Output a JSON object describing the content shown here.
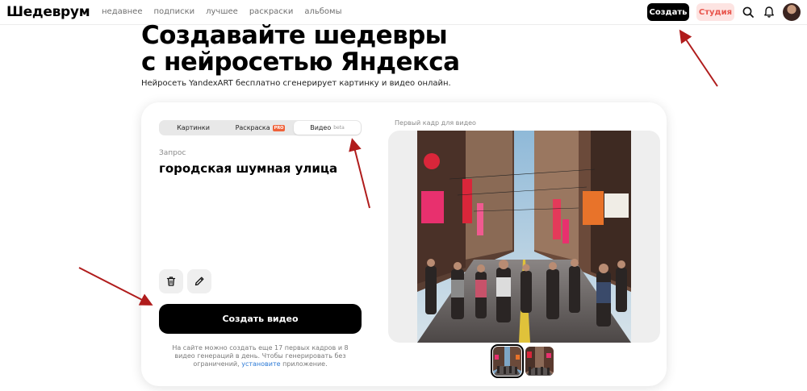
{
  "header": {
    "logo": "Шедеврум",
    "nav": [
      "недавнее",
      "подписки",
      "лучшее",
      "раскраски",
      "альбомы"
    ],
    "create_label": "Создать",
    "studio_label": "Студия"
  },
  "hero": {
    "title_line1": "Создавайте шедевры",
    "title_line2": "с нейросетью Яндекса",
    "subtitle": "Нейросеть YandexART бесплатно сгенерирует картинку и видео онлайн."
  },
  "form": {
    "tabs": [
      {
        "label": "Картинки"
      },
      {
        "label": "Раскраска",
        "badge": "PRO"
      },
      {
        "label": "Видео",
        "badge": "beta"
      }
    ],
    "active_tab": "Видео",
    "prompt_label": "Запрос",
    "prompt_value": "городская шумная улица",
    "create_video_label": "Создать видео",
    "note_text": "На сайте можно создать еще 17 первых кадров и 8 видео генераций в день. Чтобы генерировать без ограничений,",
    "note_link": "установите",
    "note_tail": "приложение."
  },
  "preview": {
    "label": "Первый кадр для видео",
    "thumbnails": 2,
    "selected_thumbnail": 1
  },
  "colors": {
    "accent": "#000000",
    "studio_bg": "#fde4e2",
    "studio_text": "#e8554c",
    "link": "#2c7ad6",
    "annotation_arrow": "#b01c1c"
  },
  "icons": [
    "search-icon",
    "bell-icon",
    "trash-icon",
    "pencil-icon"
  ]
}
